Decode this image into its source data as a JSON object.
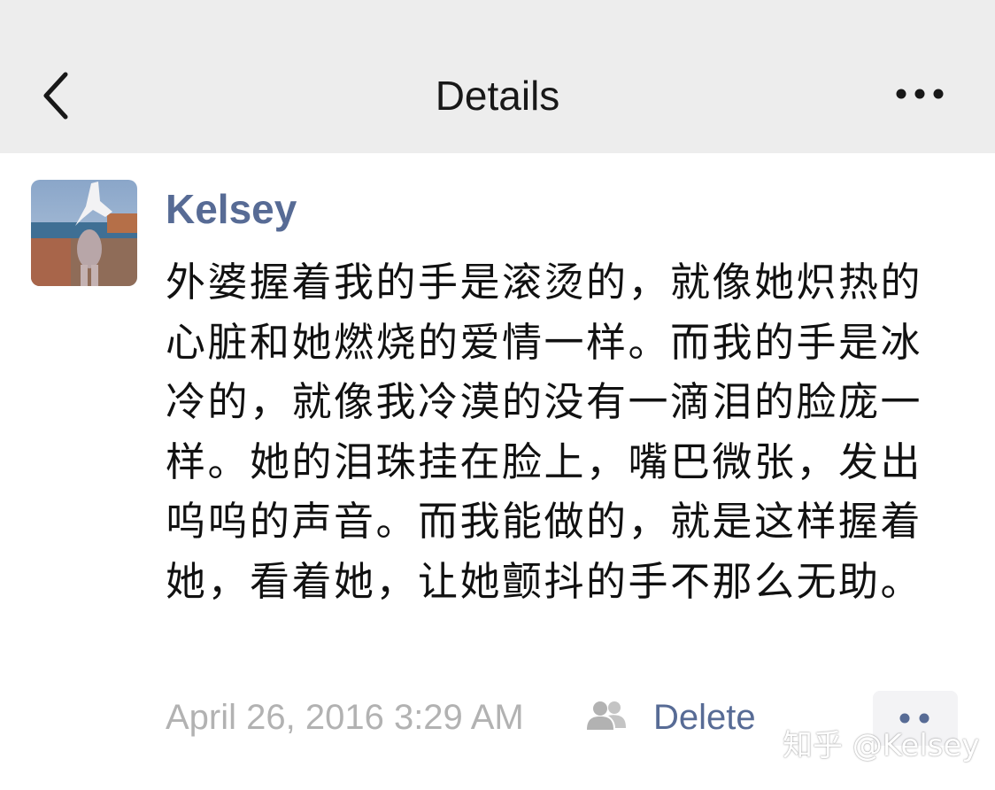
{
  "header": {
    "title": "Details",
    "back_icon": "chevron-left-icon",
    "more_icon": "more-horizontal-icon"
  },
  "post": {
    "author": "Kelsey",
    "text": "外婆握着我的手是滚烫的，就像她炽热的心脏和她燃烧的爱情一样。而我的手是冰冷的，就像我冷漠的没有一滴泪的脸庞一样。她的泪珠挂在脸上，嘴巴微张，发出呜呜的声音。而我能做的，就是这样握着她，看着她，让她颤抖的手不那么无助。",
    "timestamp": "April 26, 2016 3:29 AM",
    "visibility_icon": "friends-icon",
    "delete_label": "Delete",
    "comment_icon": "comment-dots-icon"
  },
  "watermark": "知乎 @Kelsey",
  "colors": {
    "header_bg": "#ededed",
    "link": "#576b95",
    "text": "#111111",
    "muted": "#b2b2b2"
  }
}
